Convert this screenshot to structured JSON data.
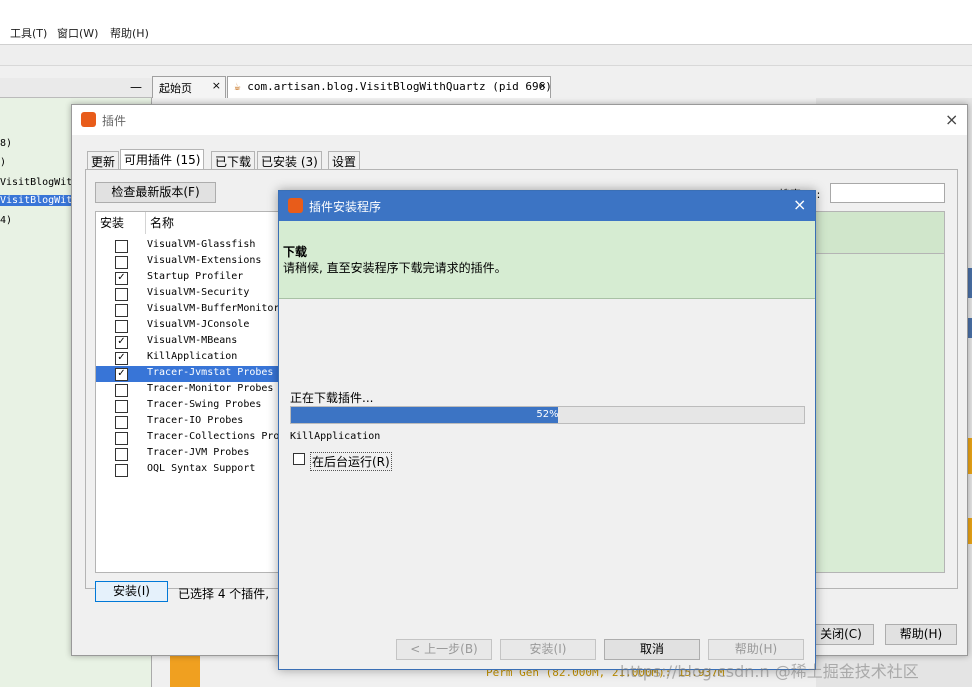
{
  "menu": [
    "工具(T)",
    "窗口(W)",
    "帮助(H)"
  ],
  "left_panel": {
    "minimize": "—",
    "tree": [
      "8)",
      ")",
      "VisitBlogWit",
      "VisitBlogWit",
      "4)"
    ]
  },
  "editor_tabs": [
    {
      "label": "起始页",
      "close": "×"
    },
    {
      "label": "com.artisan.blog.VisitBlogWithQuartz (pid 696)",
      "close": "×"
    }
  ],
  "plugins_dialog": {
    "title": "插件",
    "close": "×",
    "tabs": [
      "更新",
      "可用插件 (15)",
      "已下载",
      "已安装 (3)",
      "设置"
    ],
    "active_tab": 1,
    "check_button": "检查最新版本(F)",
    "search_label": "搜索(S):",
    "search_value": "",
    "columns": [
      "安装",
      "名称"
    ],
    "rows": [
      {
        "name": "VisualVM-Glassfish",
        "checked": false
      },
      {
        "name": "VisualVM-Extensions",
        "checked": false
      },
      {
        "name": "Startup Profiler",
        "checked": true
      },
      {
        "name": "VisualVM-Security",
        "checked": false
      },
      {
        "name": "VisualVM-BufferMonitor",
        "checked": false
      },
      {
        "name": "VisualVM-JConsole",
        "checked": false
      },
      {
        "name": "VisualVM-MBeans",
        "checked": true
      },
      {
        "name": "KillApplication",
        "checked": true
      },
      {
        "name": "Tracer-Jvmstat Probes",
        "checked": true
      },
      {
        "name": "Tracer-Monitor Probes",
        "checked": false
      },
      {
        "name": "Tracer-Swing Probes",
        "checked": false
      },
      {
        "name": "Tracer-IO Probes",
        "checked": false
      },
      {
        "name": "Tracer-Collections Pro",
        "checked": false
      },
      {
        "name": "Tracer-JVM Probes",
        "checked": false
      },
      {
        "name": "OQL Syntax Support",
        "checked": false
      }
    ],
    "selected_row": 8,
    "install_button": "安装(I)",
    "selected_count_text": "已选择 4 个插件,",
    "close_button": "关闭(C)",
    "help_button": "帮助(H)"
  },
  "installer_dialog": {
    "title": "插件安装程序",
    "close": "×",
    "header_title": "下载",
    "header_desc": "请稍候, 直至安装程序下载完请求的插件。",
    "status": "正在下载插件...",
    "progress_label": "52%",
    "progress_percent": 52,
    "current_plugin": "KillApplication",
    "background_checkbox": "在后台运行(R)",
    "background_checked": false,
    "buttons": {
      "back": "< 上一步(B)",
      "install": "安装(I)",
      "cancel": "取消",
      "help": "帮助(H)"
    }
  },
  "bottom_status": "Perm Gen (82.000M, 21.000M): 15.937M",
  "watermark": "https://blog.csdn.n @稀土掘金技术社区"
}
